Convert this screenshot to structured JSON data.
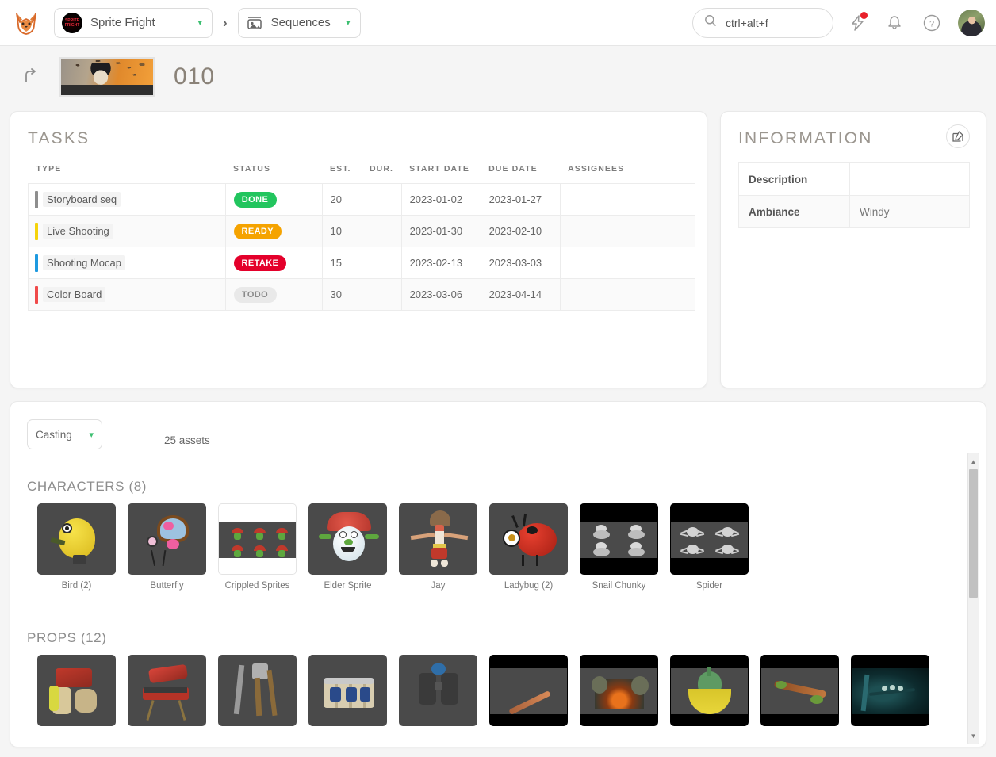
{
  "header": {
    "logo_icon": "fox-logo-icon",
    "project": {
      "label": "Sprite Fright",
      "avatar_text": "SPRITE FRIGHT"
    },
    "breadcrumb_separator": "›",
    "section": {
      "label": "Sequences",
      "icon": "image-stack-icon"
    },
    "search": {
      "value": "ctrl+alt+f",
      "placeholder": "ctrl+alt+f",
      "icon": "search-icon"
    },
    "icons": [
      {
        "name": "bolt-icon",
        "has_badge": true
      },
      {
        "name": "bell-icon",
        "has_badge": false
      },
      {
        "name": "help-circle-icon",
        "has_badge": false
      }
    ],
    "avatar": "user-avatar"
  },
  "subheader": {
    "back_icon": "back-arrow-icon",
    "thumbnail": "sequence-preview-thumbnail",
    "title": "010"
  },
  "tasks": {
    "title": "TASKS",
    "columns": [
      "TYPE",
      "STATUS",
      "EST.",
      "DUR.",
      "START DATE",
      "DUE DATE",
      "ASSIGNEES"
    ],
    "rows": [
      {
        "type": "Storyboard seq",
        "type_color": "#8e8e8e",
        "status": "DONE",
        "status_color": "#22c55e",
        "status_text_color": "#ffffff",
        "est": "20",
        "dur": "",
        "start_date": "2023-01-02",
        "due_date": "2023-01-27",
        "assignees": ""
      },
      {
        "type": "Live Shooting",
        "type_color": "#f5d30a",
        "status": "READY",
        "status_color": "#f5a300",
        "status_text_color": "#ffffff",
        "est": "10",
        "dur": "",
        "start_date": "2023-01-30",
        "due_date": "2023-02-10",
        "assignees": ""
      },
      {
        "type": "Shooting Mocap",
        "type_color": "#1e9ae0",
        "status": "RETAKE",
        "status_color": "#e4002b",
        "status_text_color": "#ffffff",
        "est": "15",
        "dur": "",
        "start_date": "2023-02-13",
        "due_date": "2023-03-03",
        "assignees": ""
      },
      {
        "type": "Color Board",
        "type_color": "#f04a4a",
        "status": "TODO",
        "status_color": "#e9e9e9",
        "status_text_color": "#8a8a8a",
        "est": "30",
        "dur": "",
        "start_date": "2023-03-06",
        "due_date": "2023-04-14",
        "assignees": ""
      }
    ]
  },
  "information": {
    "title": "INFORMATION",
    "edit_icon": "edit-pencil-icon",
    "fields": [
      {
        "key": "Description",
        "value": ""
      },
      {
        "key": "Ambiance",
        "value": "Windy"
      }
    ]
  },
  "casting": {
    "filter": {
      "label": "Casting",
      "icon": "chevron-down-icon"
    },
    "assets_count": "25 assets",
    "groups": [
      {
        "title": "CHARACTERS (8)",
        "assets": [
          {
            "name": "Bird (2)",
            "style": "dark"
          },
          {
            "name": "Butterfly",
            "style": "dark"
          },
          {
            "name": "Crippled Sprites",
            "style": "white"
          },
          {
            "name": "Elder Sprite",
            "style": "dark"
          },
          {
            "name": "Jay",
            "style": "dark"
          },
          {
            "name": "Ladybug (2)",
            "style": "dark"
          },
          {
            "name": "Snail Chunky",
            "style": "black"
          },
          {
            "name": "Spider",
            "style": "black"
          }
        ]
      },
      {
        "title": "PROPS (12)",
        "assets": [
          {
            "name": "",
            "style": "dark"
          },
          {
            "name": "",
            "style": "dark"
          },
          {
            "name": "",
            "style": "dark"
          },
          {
            "name": "",
            "style": "dark"
          },
          {
            "name": "",
            "style": "dark"
          },
          {
            "name": "",
            "style": "black"
          },
          {
            "name": "",
            "style": "black"
          },
          {
            "name": "",
            "style": "black"
          },
          {
            "name": "",
            "style": "black"
          },
          {
            "name": "",
            "style": "black"
          }
        ]
      }
    ],
    "scrollbar": {
      "up_arrow": "▲",
      "down_arrow": "▼"
    }
  },
  "colors": {
    "page_bg": "#f5f5f5",
    "panel_bg": "#ffffff",
    "accent_green": "#3dbf71",
    "title_grey": "#9b968f"
  }
}
